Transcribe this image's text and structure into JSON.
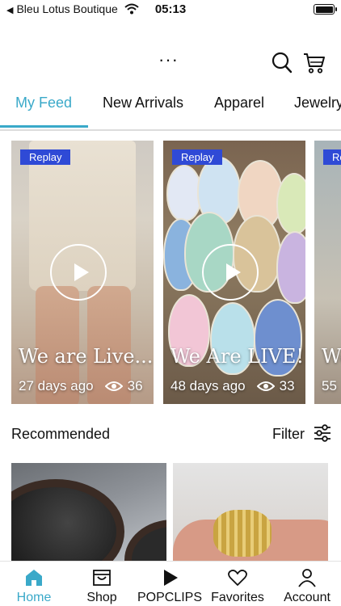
{
  "status_bar": {
    "back_label": "Bleu Lotus Boutique",
    "time": "05:13"
  },
  "header": {
    "more_label": "···",
    "icons": [
      "search-icon",
      "cart-icon"
    ]
  },
  "tabs": [
    {
      "label": "My Feed",
      "active": true
    },
    {
      "label": "New Arrivals",
      "active": false
    },
    {
      "label": "Apparel",
      "active": false
    },
    {
      "label": "Jewelry",
      "active": false
    }
  ],
  "videos": [
    {
      "badge": "Replay",
      "title": "We are Live...",
      "age": "27 days ago",
      "views": "36"
    },
    {
      "badge": "Replay",
      "title": "We Are LIVE!!!",
      "age": "48 days ago",
      "views": "33"
    },
    {
      "badge": "Replay",
      "title": "We",
      "age": "55",
      "views": ""
    }
  ],
  "recommended": {
    "label": "Recommended",
    "filter_label": "Filter"
  },
  "bottom_nav": [
    {
      "label": "Home",
      "icon": "home-icon",
      "active": true
    },
    {
      "label": "Shop",
      "icon": "shop-icon",
      "active": false
    },
    {
      "label": "POPCLIPS",
      "icon": "popclips-icon",
      "active": false
    },
    {
      "label": "Favorites",
      "icon": "heart-icon",
      "active": false
    },
    {
      "label": "Account",
      "icon": "person-icon",
      "active": false
    }
  ],
  "colors": {
    "accent": "#3aa9c9",
    "badge": "#2f4ad6"
  }
}
